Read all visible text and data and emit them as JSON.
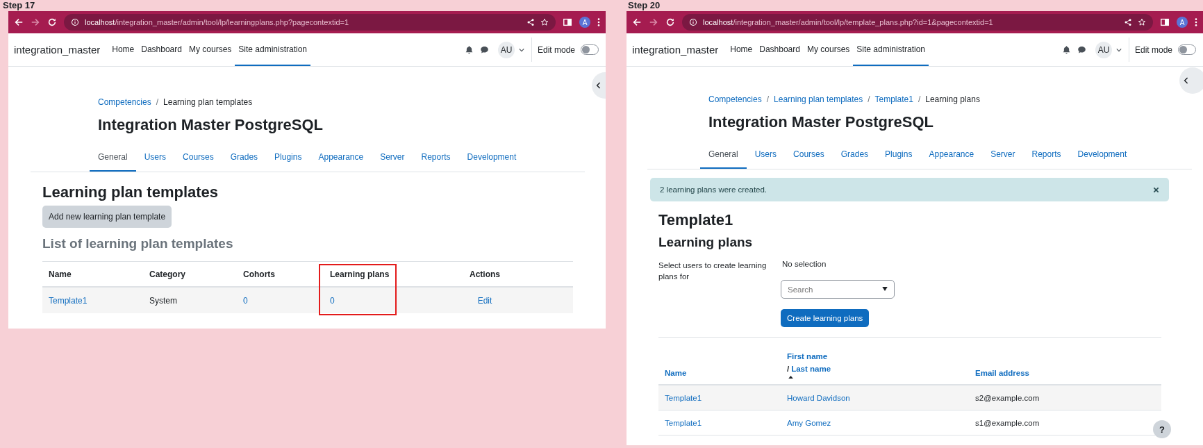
{
  "panels": [
    {
      "kind": "template_list",
      "step": "Step 17",
      "url": {
        "host": "localhost",
        "path": "/integration_master/admin/tool/lp/learningplans.php?pagecontextid=1"
      },
      "profile_initial": "A",
      "nav": {
        "brand": "integration_master",
        "links": [
          {
            "label": "Home",
            "selected": false
          },
          {
            "label": "Dashboard",
            "selected": false
          },
          {
            "label": "My courses",
            "selected": false
          },
          {
            "label": "Site administration",
            "selected": true
          }
        ],
        "user_initials": "AU",
        "edit_mode": {
          "label": "Edit mode",
          "on": false
        }
      },
      "breadcrumb": [
        {
          "label": "Competencies",
          "link": true
        },
        {
          "separator": "/",
          "label": "Learning plan templates",
          "link": false
        }
      ],
      "title": "Integration Master PostgreSQL",
      "tabs": [
        {
          "label": "General",
          "selected": true
        },
        {
          "label": "Users",
          "selected": false
        },
        {
          "label": "Courses",
          "selected": false
        },
        {
          "label": "Grades",
          "selected": false
        },
        {
          "label": "Plugins",
          "selected": false
        },
        {
          "label": "Appearance",
          "selected": false
        },
        {
          "label": "Server",
          "selected": false
        },
        {
          "label": "Reports",
          "selected": false
        },
        {
          "label": "Development",
          "selected": false
        }
      ],
      "heading": "Learning plan templates",
      "add_button": "Add new learning plan template",
      "subheading": "List of learning plan templates",
      "table": {
        "columns": [
          {
            "label": "Name",
            "highlighted": false
          },
          {
            "label": "Category",
            "highlighted": false
          },
          {
            "label": "Cohorts",
            "highlighted": false
          },
          {
            "label": "Learning plans",
            "highlighted": true
          },
          {
            "label": "Actions",
            "highlighted": false
          }
        ],
        "rows": [
          [
            {
              "text": "Template1",
              "link": true
            },
            {
              "text": "System",
              "link": false
            },
            {
              "text": "0",
              "link": true
            },
            {
              "text": "0",
              "link": true
            },
            {
              "text": "Edit",
              "link": true
            }
          ]
        ]
      }
    },
    {
      "kind": "template_plans",
      "step": "Step 20",
      "url": {
        "host": "localhost",
        "path": "/integration_master/admin/tool/lp/template_plans.php?id=1&pagecontextid=1"
      },
      "profile_initial": "A",
      "nav": {
        "brand": "integration_master",
        "links": [
          {
            "label": "Home",
            "selected": false
          },
          {
            "label": "Dashboard",
            "selected": false
          },
          {
            "label": "My courses",
            "selected": false
          },
          {
            "label": "Site administration",
            "selected": true
          }
        ],
        "user_initials": "AU",
        "edit_mode": {
          "label": "Edit mode",
          "on": false
        }
      },
      "breadcrumb": [
        {
          "label": "Competencies",
          "link": true
        },
        {
          "separator": "/",
          "label": "Learning plan templates",
          "link": true
        },
        {
          "separator": "/",
          "label": "Template1",
          "link": true
        },
        {
          "separator": "/",
          "label": "Learning plans",
          "link": false
        }
      ],
      "title": "Integration Master PostgreSQL",
      "tabs": [
        {
          "label": "General",
          "selected": true
        },
        {
          "label": "Users",
          "selected": false
        },
        {
          "label": "Courses",
          "selected": false
        },
        {
          "label": "Grades",
          "selected": false
        },
        {
          "label": "Plugins",
          "selected": false
        },
        {
          "label": "Appearance",
          "selected": false
        },
        {
          "label": "Server",
          "selected": false
        },
        {
          "label": "Reports",
          "selected": false
        },
        {
          "label": "Development",
          "selected": false
        }
      ],
      "alert": "2 learning plans were created.",
      "heading": "Template1",
      "subheading": "Learning plans",
      "form": {
        "label": "Select users to create learning plans for",
        "selection": "No selection",
        "search_placeholder": "Search",
        "submit": "Create learning plans"
      },
      "table": {
        "columns": [
          {
            "label": "Name",
            "sorted": false
          },
          {
            "label": "First name",
            "separator": "/",
            "label_2": "Last name",
            "sorted": true
          },
          {
            "label": "Email address",
            "sorted": false
          }
        ],
        "rows": [
          [
            {
              "text": "Template1",
              "link": true
            },
            {
              "text": "Howard Davidson",
              "link": true
            },
            {
              "text": "s2@example.com",
              "link": false
            }
          ],
          [
            {
              "text": "Template1",
              "link": true
            },
            {
              "text": "Amy Gomez",
              "link": true
            },
            {
              "text": "s1@example.com",
              "link": false
            }
          ]
        ]
      },
      "help": "?"
    }
  ]
}
